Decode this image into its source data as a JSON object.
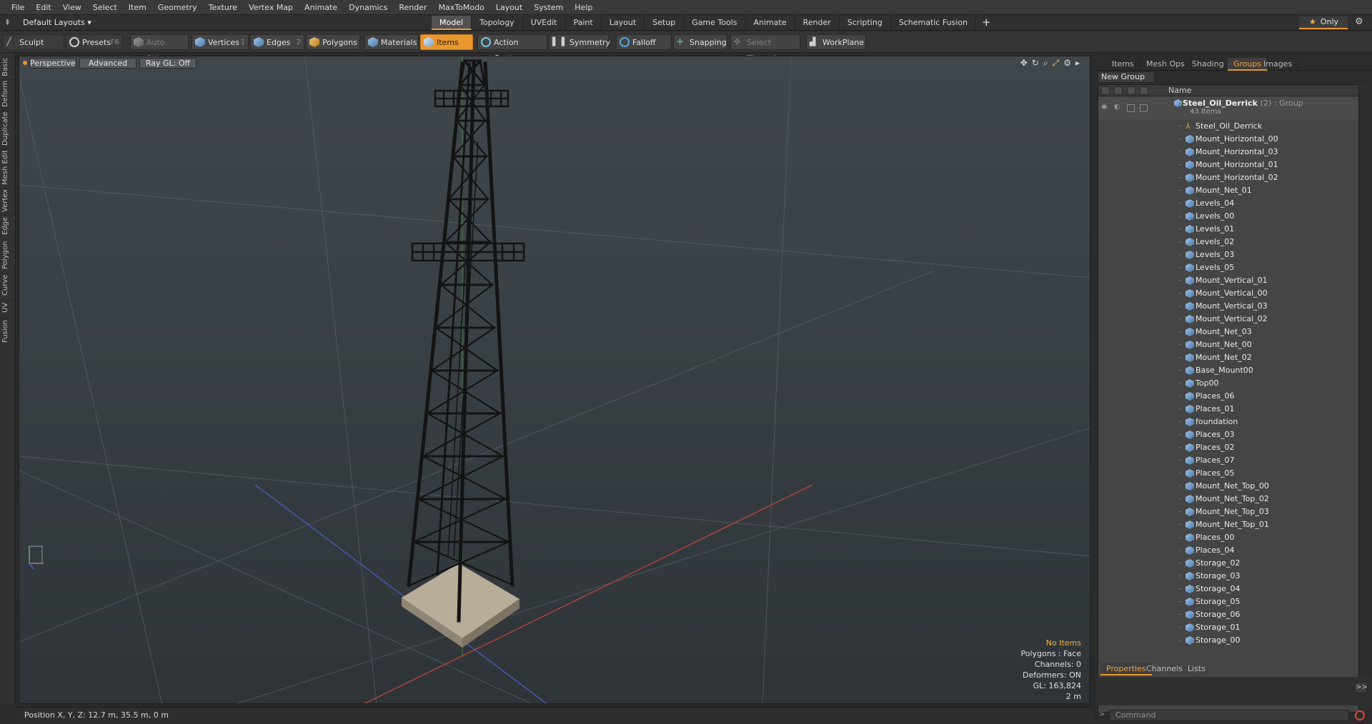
{
  "menu": [
    "File",
    "Edit",
    "View",
    "Select",
    "Item",
    "Geometry",
    "Texture",
    "Vertex Map",
    "Animate",
    "Dynamics",
    "Render",
    "MaxToModo",
    "Layout",
    "System",
    "Help"
  ],
  "layout": {
    "dropdown": "Default Layouts",
    "tabs": [
      "Model",
      "Topology",
      "UVEdit",
      "Paint",
      "Layout",
      "Setup",
      "Game Tools",
      "Animate",
      "Render",
      "Scripting",
      "Schematic Fusion"
    ],
    "active_tab": "Model",
    "only_label": "Only"
  },
  "toolbar": {
    "sculpt": "Sculpt",
    "presets": "Presets",
    "presets_key": "F6",
    "auto_select": "Auto Select",
    "vertices": "Vertices",
    "vertices_key": "1",
    "edges": "Edges",
    "edges_key": "2",
    "polygons": "Polygons",
    "materials": "Materials",
    "items": "Items",
    "action_center": "Action Center",
    "symmetry": "Symmetry",
    "falloff": "Falloff",
    "snapping": "Snapping",
    "select_through": "Select Through",
    "workplane": "WorkPlane"
  },
  "left_tabs": [
    "Basic",
    "Deform",
    "Duplicate",
    "Mesh Edit",
    "Vertex",
    "Edge",
    "Polygon",
    "Curve",
    "UV",
    "Fusion"
  ],
  "viewport": {
    "view": "Perspective",
    "shading": "Advanced",
    "raygl": "Ray GL: Off",
    "info": {
      "selection": "No Items",
      "polygons": "Polygons : Face",
      "channels": "Channels: 0",
      "deformers": "Deformers: ON",
      "gl": "GL: 163,824",
      "scale": "2 m"
    }
  },
  "status": "Position X, Y, Z:   12.7 m, 35.5 m, 0 m",
  "right_panel": {
    "tabs": [
      "Items",
      "Mesh Ops",
      "Shading",
      "Groups",
      "Images"
    ],
    "active_tab": "Groups",
    "new_group": "New Group",
    "column_name": "Name",
    "group": {
      "name": "Steel_Oil_Derrick",
      "count": "(2)",
      "type": ": Group",
      "items_label": "43 Items"
    },
    "items": [
      "Steel_Oil_Derrick",
      "Mount_Horizontal_00",
      "Mount_Horizontal_03",
      "Mount_Horizontal_01",
      "Mount_Horizontal_02",
      "Mount_Net_01",
      "Levels_04",
      "Levels_00",
      "Levels_01",
      "Levels_02",
      "Levels_03",
      "Levels_05",
      "Mount_Vertical_01",
      "Mount_Vertical_00",
      "Mount_Vertical_03",
      "Mount_Vertical_02",
      "Mount_Net_03",
      "Mount_Net_00",
      "Mount_Net_02",
      "Base_Mount00",
      "Top00",
      "Places_06",
      "Places_01",
      "foundation",
      "Places_03",
      "Places_02",
      "Places_07",
      "Places_05",
      "Mount_Net_Top_00",
      "Mount_Net_Top_02",
      "Mount_Net_Top_03",
      "Mount_Net_Top_01",
      "Places_00",
      "Places_04",
      "Storage_02",
      "Storage_03",
      "Storage_04",
      "Storage_05",
      "Storage_06",
      "Storage_01",
      "Storage_00"
    ],
    "bottom_tabs": [
      "Properties",
      "Channels",
      "Lists"
    ],
    "bottom_active": "Properties",
    "command_placeholder": "Command",
    "arrow_label": ">>"
  }
}
